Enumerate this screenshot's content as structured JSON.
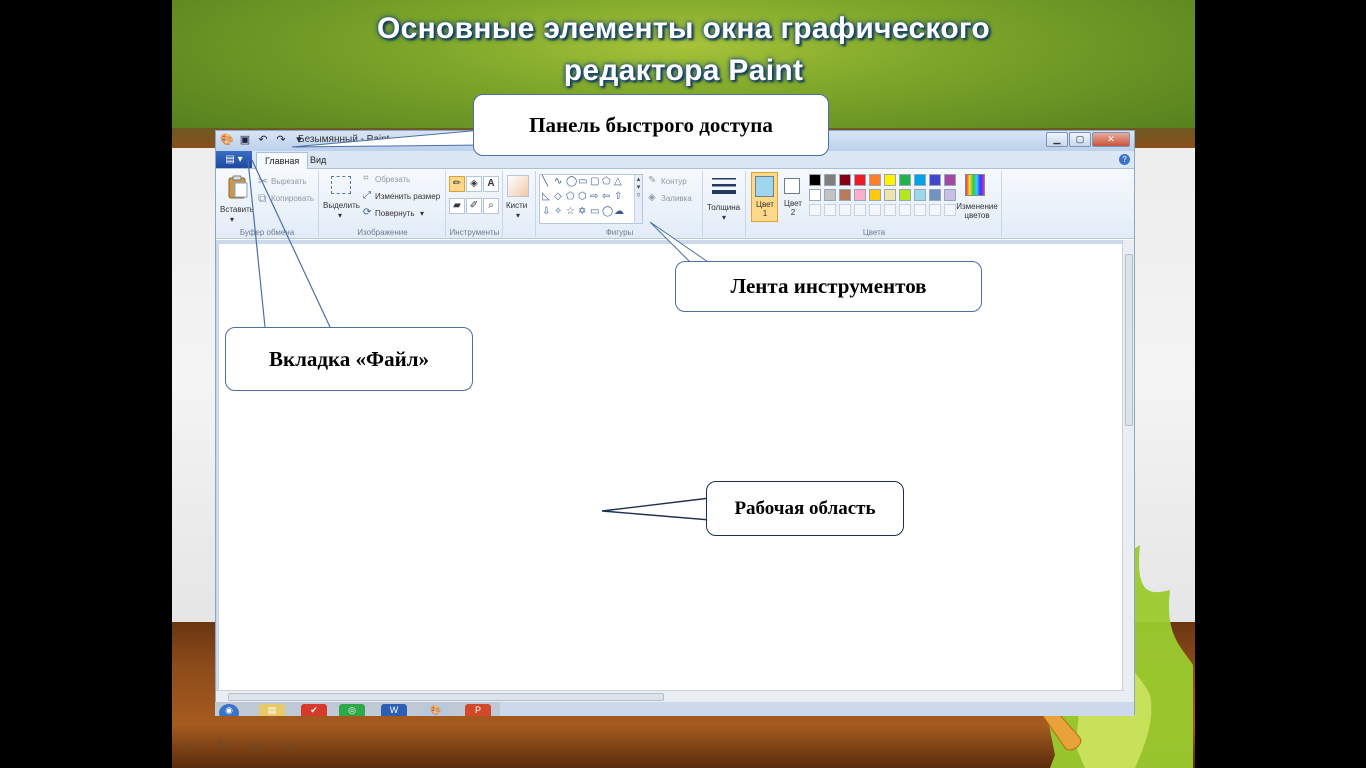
{
  "slide": {
    "title_line1": "Основные элементы окна графического",
    "title_line2": "редактора Paint"
  },
  "paint": {
    "window_title": "Безымянный - Paint",
    "qat_icons": [
      "paint-app-icon",
      "save-icon",
      "undo-icon",
      "redo-icon",
      "qat-dropdown-icon"
    ],
    "window_controls": [
      "minimize",
      "maximize",
      "close"
    ],
    "file_tab_icon": "file-menu-icon",
    "tabs": [
      "Главная",
      "Вид"
    ],
    "ribbon": {
      "clipboard": {
        "label": "Буфер обмена",
        "paste": "Вставить",
        "cut": "Вырезать",
        "copy": "Копировать"
      },
      "image": {
        "label": "Изображение",
        "select": "Выделить",
        "crop": "Обрезать",
        "resize": "Изменить размер",
        "rotate": "Повернуть"
      },
      "tools": {
        "label": "Инструменты",
        "items": [
          "pencil-icon",
          "fill-icon",
          "text-icon",
          "eraser-icon",
          "color-picker-icon",
          "magnifier-icon"
        ]
      },
      "brushes": {
        "label": "Кисти"
      },
      "shapes": {
        "label": "Фигуры",
        "outline": "Контур",
        "fill": "Заливка"
      },
      "size": {
        "label": "Толщина"
      },
      "colors": {
        "label": "Цвета",
        "color1": "Цвет 1",
        "color2": "Цвет 2",
        "edit_colors": "Изменение цветов",
        "color1_value": "#9fd6ee",
        "color2_value": "#ffffff",
        "palette_row1": [
          "#000000",
          "#7f7f7f",
          "#880015",
          "#ed1c24",
          "#ff7f27",
          "#fff200",
          "#22b14c",
          "#00a2e8",
          "#3f48cc",
          "#a349a4"
        ],
        "palette_row2": [
          "#ffffff",
          "#c3c3c3",
          "#b97a57",
          "#ffaec9",
          "#ffc90e",
          "#efe4b0",
          "#b5e61d",
          "#99d9ea",
          "#7092be",
          "#c8bfe7"
        ]
      }
    }
  },
  "callouts": {
    "qat": "Панель быстрого доступа",
    "ribbon": "Лента инструментов",
    "file_tab": "Вкладка «Файл»",
    "work_area": "Рабочая область"
  },
  "navigation": {
    "icons": [
      "previous-slide-icon",
      "pen-icon",
      "slide-menu-icon",
      "next-slide-icon"
    ]
  }
}
